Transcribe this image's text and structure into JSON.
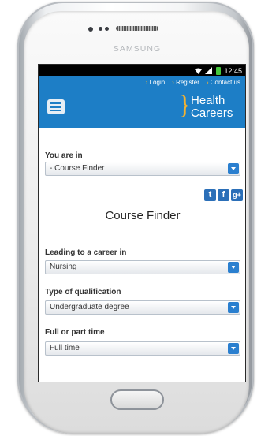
{
  "device": {
    "brand": "SAMSUNG"
  },
  "statusbar": {
    "time": "12:45"
  },
  "header": {
    "links": [
      "Login",
      "Register",
      "Contact us"
    ],
    "logo_line1": "Health",
    "logo_line2": "Careers",
    "colors": {
      "header_bg": "#1d7ec6",
      "accent": "#f2b233"
    }
  },
  "content": {
    "you_are_in_label": "You are in",
    "you_are_in_value": "- Course Finder",
    "social": {
      "twitter": "t",
      "facebook": "f",
      "google_plus": "g+"
    },
    "page_title": "Course Finder",
    "filters": [
      {
        "label": "Leading to a career in",
        "value": "Nursing"
      },
      {
        "label": "Type of qualification",
        "value": "Undergraduate degree"
      },
      {
        "label": "Full or part time",
        "value": "Full time"
      }
    ]
  }
}
